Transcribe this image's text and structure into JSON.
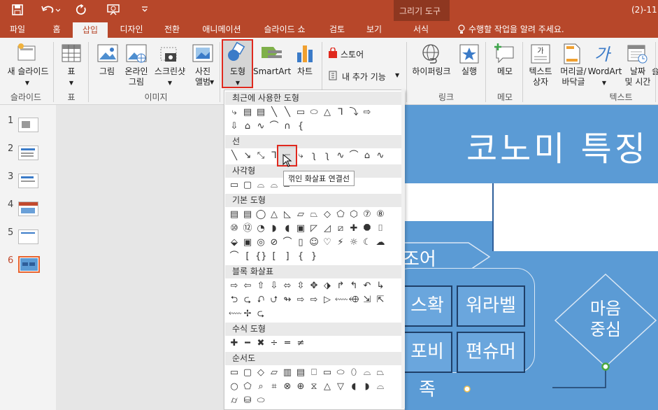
{
  "titlebar": {
    "context_group": "그리기 도구",
    "doc_title": "(2)-11",
    "qat": [
      "save-icon",
      "undo-icon",
      "redo-icon",
      "present-icon",
      "customize-icon"
    ]
  },
  "tabs": [
    "파일",
    "홈",
    "삽입",
    "디자인",
    "전환",
    "애니메이션",
    "슬라이드 쇼",
    "검토",
    "보기"
  ],
  "context_tab": "서식",
  "tell_me": "수행할 작업을 알려 주세요.",
  "ribbon": {
    "new_slide": "새 슬라이드",
    "table": "표",
    "picture": "그림",
    "online_picture_1": "온라인",
    "online_picture_2": "그림",
    "screenshot": "스크린샷",
    "album_1": "사진",
    "album_2": "앨범",
    "shapes": "도형",
    "smartart": "SmartArt",
    "chart": "차트",
    "store": "스토어",
    "my_addins": "내 추가 기능",
    "hyperlink": "하이퍼링크",
    "action": "실행",
    "comment": "메모",
    "textbox_1": "텍스트",
    "textbox_2": "상자",
    "header_1": "머리글/",
    "header_2": "바닥글",
    "wordart": "WordArt",
    "datetime_1": "날짜",
    "datetime_2": "및 시간",
    "slide_no": "슬"
  },
  "groups": {
    "slides": "슬라이드",
    "table": "표",
    "images": "이미지",
    "links": "링크",
    "comments": "메모",
    "text": "텍스트"
  },
  "slides": [
    "1",
    "2",
    "3",
    "4",
    "5",
    "6"
  ],
  "active_slide": "6",
  "gallery": {
    "recent": "최근에 사용한 도형",
    "lines": "선",
    "rectangles": "사각형",
    "basic": "기본 도형",
    "block_arrows": "블록 화살표",
    "equation": "수식 도형",
    "flowchart": "순서도",
    "tooltip": "꺾인 화살표 연결선"
  },
  "slide": {
    "title": "코노미 특징",
    "arrow_label": "조어",
    "boxes": [
      "스확행",
      "워라벨",
      "포비족",
      "편슈머"
    ],
    "diamond_1": "마음",
    "diamond_2": "중심"
  },
  "colors": {
    "accent": "#b7472a",
    "slide_bg": "#5b9bd5",
    "highlight": "#e0291e"
  }
}
